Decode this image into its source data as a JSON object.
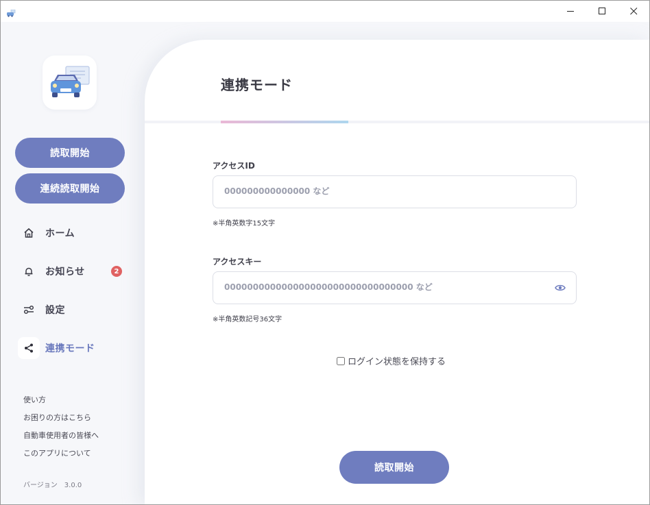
{
  "titlebar": {
    "icon": "car-app-icon",
    "minimize_icon": "minimize-icon",
    "maximize_icon": "maximize-icon",
    "close_icon": "close-icon"
  },
  "sidebar": {
    "logo_icon": "car-document-logo",
    "start_read_label": "読取開始",
    "continuous_read_label": "連続読取開始",
    "nav": [
      {
        "label": "ホーム",
        "icon": "home-icon"
      },
      {
        "label": "お知らせ",
        "icon": "bell-icon",
        "badge": "2"
      },
      {
        "label": "設定",
        "icon": "sliders-icon"
      },
      {
        "label": "連携モード",
        "icon": "share-icon",
        "active": true
      }
    ],
    "links": [
      "使い方",
      "お困りの方はこちら",
      "自動車使用者の皆様へ",
      "このアプリについて"
    ],
    "version_label": "バージョン　3.0.0"
  },
  "main": {
    "title": "連携モード",
    "access_id": {
      "label": "アクセスID",
      "placeholder": "000000000000000 など",
      "value": "",
      "hint": "※半角英数字15文字"
    },
    "access_key": {
      "label": "アクセスキー",
      "placeholder": "000000000000000000000000000000000 など",
      "value": "",
      "hint": "※半角英数記号36文字",
      "toggle_icon": "eye-icon"
    },
    "remember_label": "ログイン状態を保持する",
    "remember_checked": false,
    "read_button_label": "読取開始"
  },
  "colors": {
    "accent": "#6f7dbf",
    "badge": "#e06262",
    "underline_start": "#eab8d6",
    "underline_end": "#aed6ee",
    "sidebar_bg": "#f6f7fa"
  }
}
